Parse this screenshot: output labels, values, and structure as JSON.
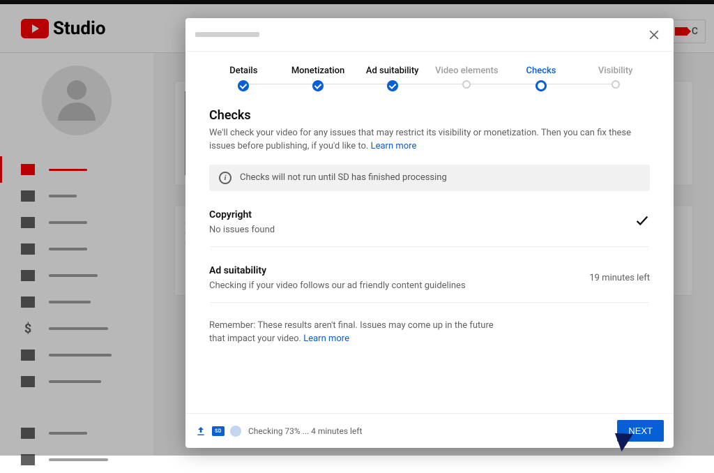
{
  "brand": {
    "studio": "Studio",
    "create_label": "C"
  },
  "stepper": {
    "steps": [
      {
        "label": "Details"
      },
      {
        "label": "Monetization"
      },
      {
        "label": "Ad suitability"
      },
      {
        "label": "Video elements"
      },
      {
        "label": "Checks"
      },
      {
        "label": "Visibility"
      }
    ]
  },
  "checks": {
    "heading": "Checks",
    "description": "We'll check your video for any issues that may restrict its visibility or monetization. Then you can fix these issues before publishing, if you'd like to. ",
    "learn_more": "Learn more",
    "notice": "Checks will not run until SD has finished processing",
    "copyright": {
      "title": "Copyright",
      "status": "No issues found"
    },
    "ad_suitability": {
      "title": "Ad suitability",
      "status": "Checking if your video follows our ad friendly content guidelines",
      "eta": "19 minutes left"
    },
    "remember": "Remember: These results aren't final. Issues may come up in the future that impact your video. ",
    "remember_link": "Learn more"
  },
  "footer": {
    "sd_label": "SD",
    "status": "Checking 73% ... 4 minutes left",
    "next": "NEXT"
  }
}
